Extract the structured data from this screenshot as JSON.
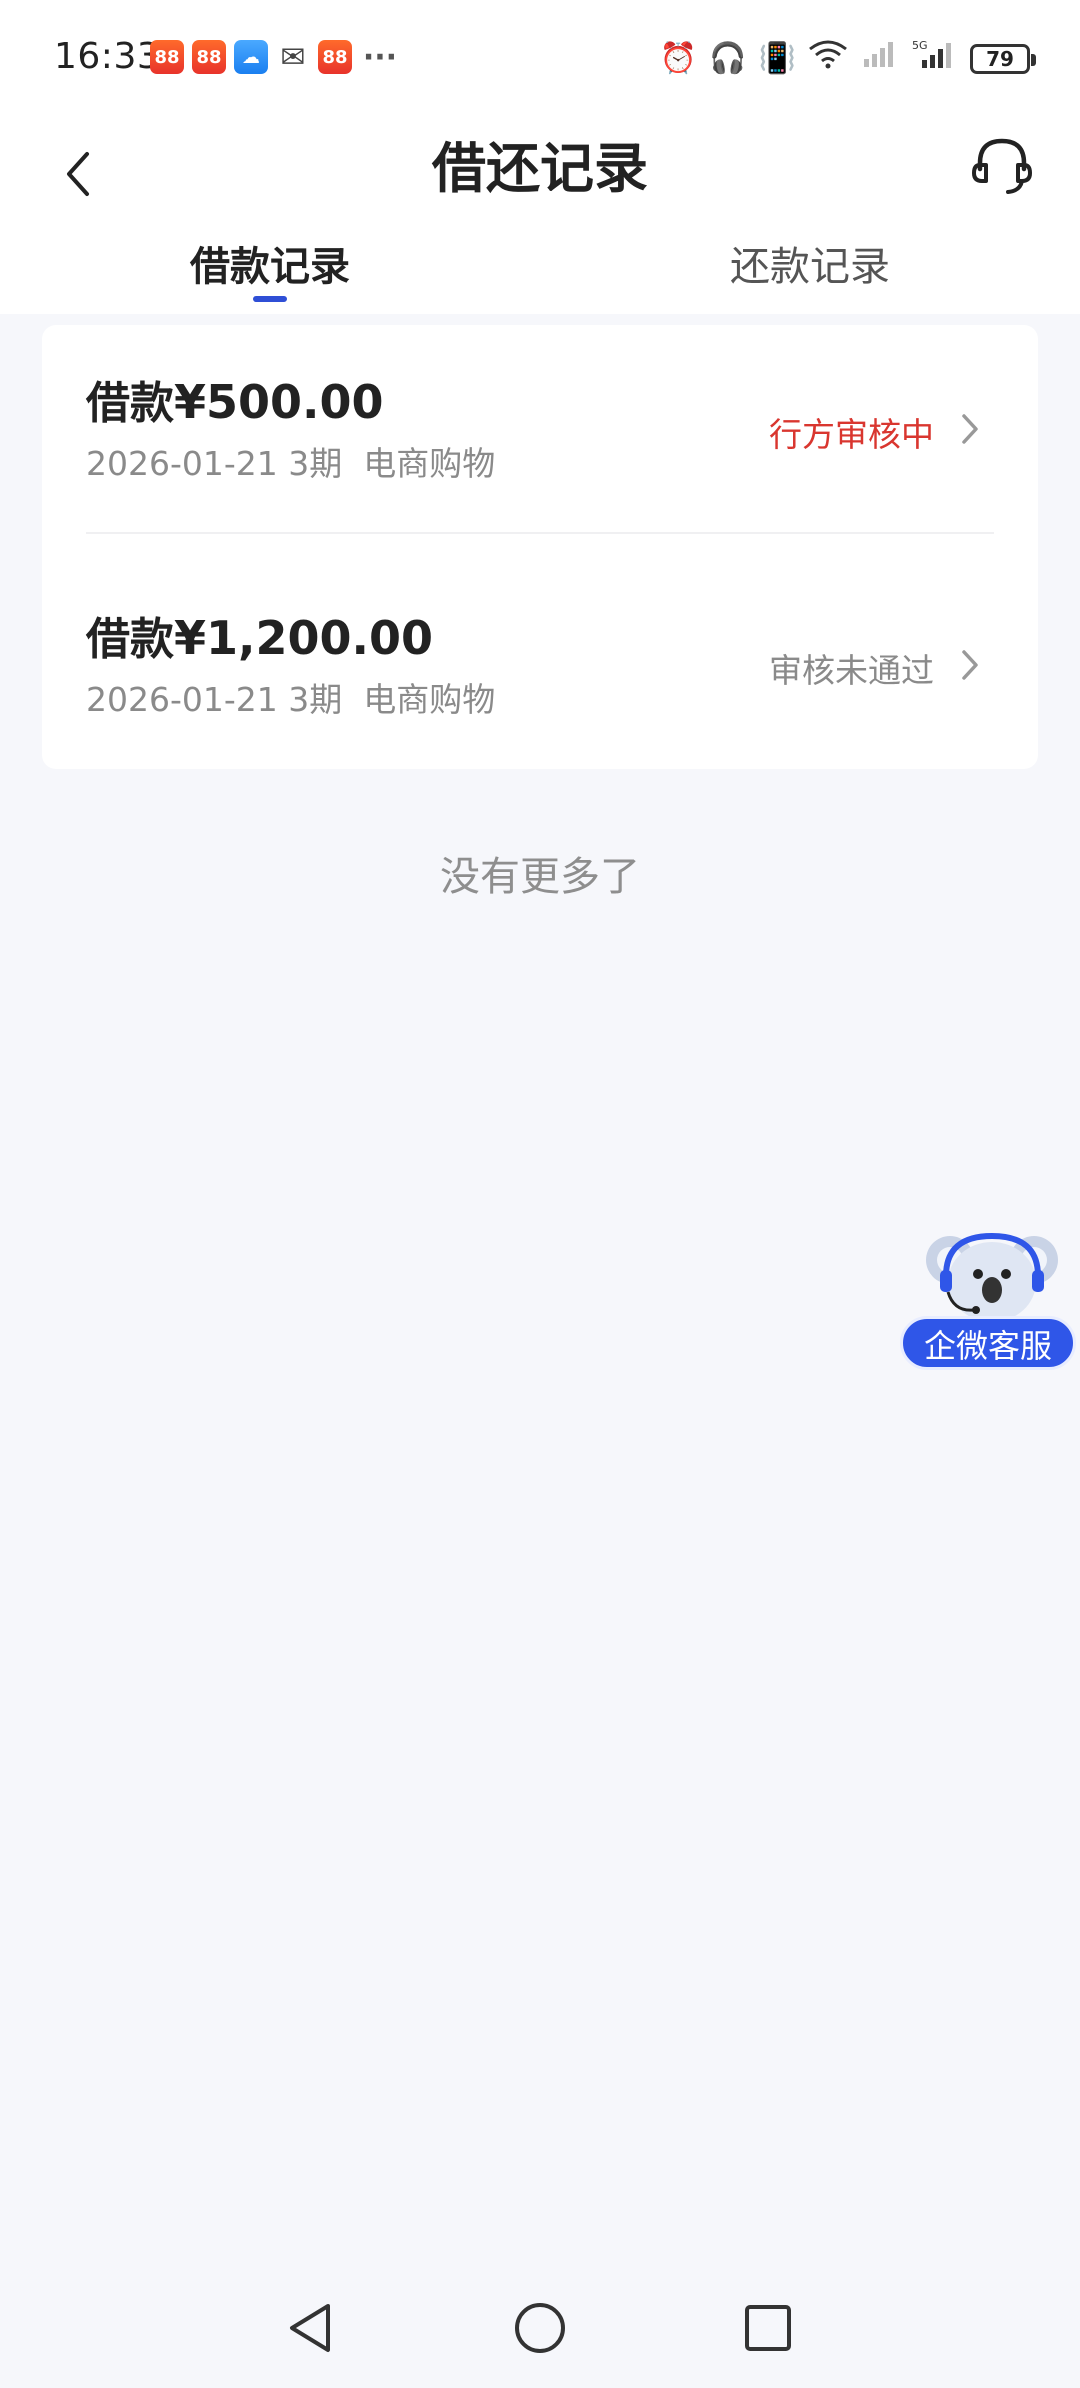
{
  "status_bar": {
    "time": "16:33",
    "notifications": [
      "88",
      "88",
      "weather-icon",
      "wechat-icon",
      "88"
    ],
    "more": "···",
    "battery": "79",
    "network": "5G"
  },
  "header": {
    "title": "借还记录"
  },
  "tabs": [
    {
      "label": "借款记录",
      "active": true
    },
    {
      "label": "还款记录",
      "active": false
    }
  ],
  "records": [
    {
      "title_prefix": "借款",
      "amount": "¥500.00",
      "meta": "2026-01-21 3期  电商购物",
      "status": "行方审核中"
    },
    {
      "title_prefix": "借款",
      "amount": "¥1,200.00",
      "meta": "2026-01-21 3期  电商购物",
      "status": "审核未通过"
    }
  ],
  "list_footer": "没有更多了",
  "float_service": {
    "label": "企微客服"
  },
  "colors": {
    "accent": "#2f4fd6",
    "status_pending": "#d9362f",
    "status_rejected": "#8a8a8a",
    "background": "#f6f7fb"
  }
}
